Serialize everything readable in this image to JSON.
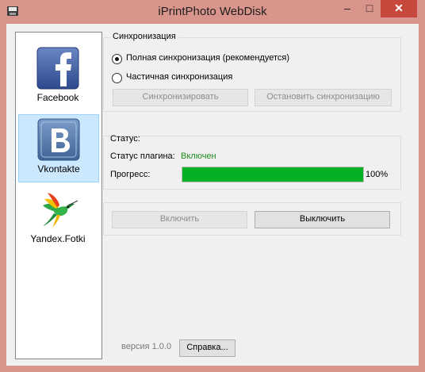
{
  "window": {
    "title": "iPrintPhoto WebDisk"
  },
  "sidebar": {
    "items": [
      {
        "label": "Facebook",
        "icon": "facebook-icon",
        "selected": false
      },
      {
        "label": "Vkontakte",
        "icon": "vkontakte-icon",
        "selected": true
      },
      {
        "label": "Yandex.Fotki",
        "icon": "hummingbird-icon",
        "selected": false
      }
    ]
  },
  "sync": {
    "group_title": "Синхронизация",
    "option_full": "Полная синхронизация (рекомендуется)",
    "option_partial": "Частичная синхронизация",
    "selected_option": "full",
    "sync_button": "Синхронизировать",
    "stop_button": "Остановить синхронизацию"
  },
  "status": {
    "group_title": "Статус:",
    "plugin_label": "Статус плагина:",
    "plugin_value": "Включен",
    "progress_label": "Прогресс:",
    "progress_percent": 100,
    "progress_text": "100%"
  },
  "actions": {
    "enable_button": "Включить",
    "disable_button": "Выключить"
  },
  "footer": {
    "version": "версия 1.0.0",
    "help_button": "Справка..."
  },
  "colors": {
    "accent_green": "#06b025",
    "status_green": "#1e8b1e",
    "close_red": "#c7483d"
  }
}
